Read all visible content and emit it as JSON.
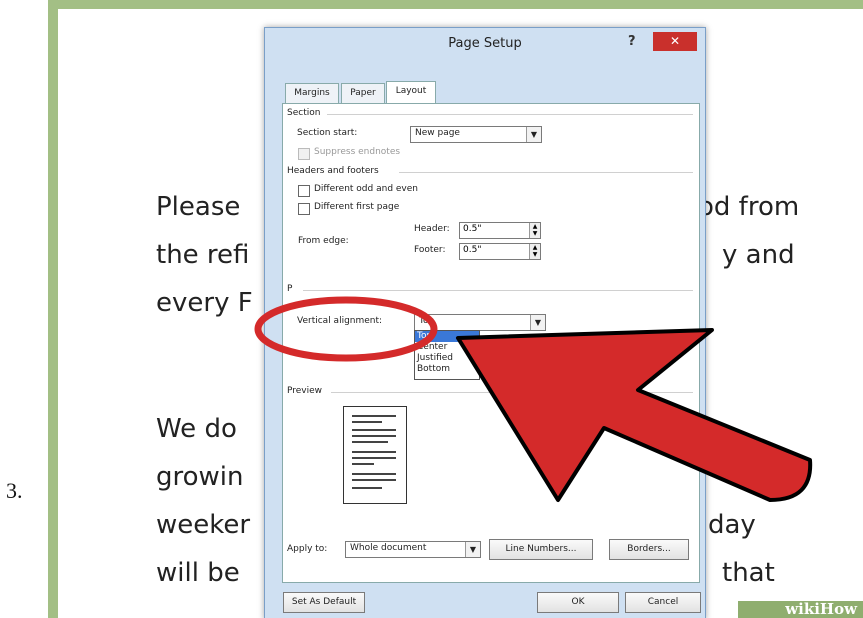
{
  "step_number": "3.",
  "document_text": {
    "line1_left": "Please",
    "line1_right": "od from",
    "line2_left": "the refi",
    "line2_right": "y and",
    "line3_left": "every F",
    "line4_left": "We do",
    "line5_left": "growin",
    "line6_left": "weeker",
    "line6_right": "day",
    "line7_left": "will be",
    "line7_right": "that"
  },
  "dialog": {
    "title": "Page Setup",
    "help": "?",
    "close": "✕",
    "tabs": [
      "Margins",
      "Paper",
      "Layout"
    ],
    "active_tab": "Layout",
    "section": {
      "heading": "Section",
      "section_start_label": "Section start:",
      "section_start_value": "New page",
      "suppress_endnotes": "Suppress endnotes"
    },
    "headers_footers": {
      "heading": "Headers and footers",
      "different_odd_even": "Different odd and even",
      "different_first_page": "Different first page",
      "from_edge": "From edge:",
      "header_label": "Header:",
      "header_value": "0.5\"",
      "footer_label": "Footer:",
      "footer_value": "0.5\""
    },
    "page": {
      "heading": "P",
      "vertical_alignment_label": "Vertical alignment:",
      "vertical_alignment_options": [
        "Top",
        "Center",
        "Justified",
        "Bottom"
      ],
      "vertical_alignment_selected": "Top"
    },
    "preview": {
      "heading": "Preview"
    },
    "apply_to_label": "Apply to:",
    "apply_to_value": "Whole document",
    "line_numbers_button": "Line Numbers...",
    "borders_button": "Borders...",
    "set_default_button": "Set As Default",
    "ok_button": "OK",
    "cancel_button": "Cancel"
  },
  "watermark": "wikiHow",
  "colors": {
    "frame_green": "#a3bf85",
    "annotation_red": "#d42a2a",
    "close_red": "#c9302c",
    "selection_blue": "#3a78d8"
  },
  "icons": [
    "close-icon",
    "dropdown-arrow-icon",
    "spinner-icon",
    "arrow-annotation",
    "circle-annotation"
  ]
}
